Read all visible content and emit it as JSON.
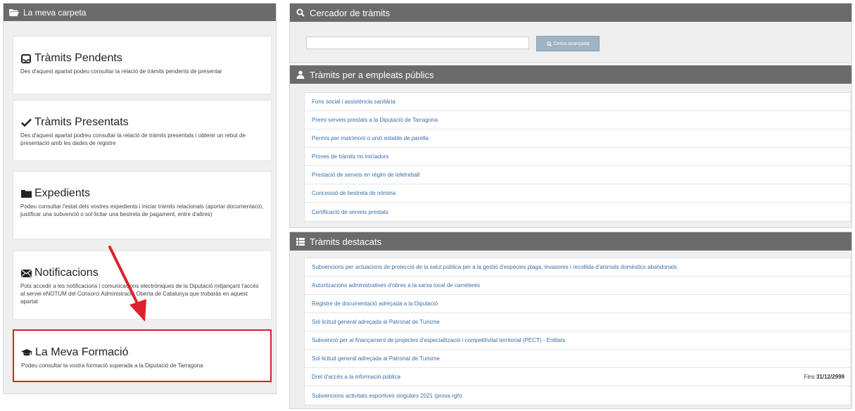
{
  "left_panel": {
    "title": "La meva carpeta",
    "cards": [
      {
        "title": "Tràmits Pendents",
        "desc": "Des d'aquest apartat podeu consultar la relació de tràmits pendents de presentar",
        "icon": "inbox-icon"
      },
      {
        "title": "Tràmits Presentats",
        "desc": "Des d'aquest apartat podreu consultar la relació de tràmits presentats i obtenir un rebut de presentació amb les dades de registre",
        "icon": "check-icon"
      },
      {
        "title": "Expedients",
        "desc": "Podeu consultar l'estat dels vostres expedients i iniciar tràmits relacionats (aportar documentació, justificar una subvenció o sol·licitar una bestreta de pagament, entre d'altres)",
        "icon": "folder-icon"
      },
      {
        "title": "Notificacions",
        "desc": "Pots accedir a les notificacions i comunicacions electròniques de la Diputació mitjançant l'accés al servei eNOTUM del Consorci Administració Oberta de Catalunya que trobaràs en aquest apartat",
        "icon": "envelope-icon"
      },
      {
        "title": "La Meva Formació",
        "desc": "Podeu consultar la vostra formació superada a la Diputació de Tarragona",
        "icon": "graduation-cap-icon"
      }
    ]
  },
  "search_panel": {
    "title": "Cercador de tràmits",
    "input_value": "",
    "button_label": "Cerca avançada"
  },
  "employees_panel": {
    "title": "Tràmits per a empleats públics",
    "items": [
      "Fons social i assistència sanitària",
      "Premi serveis prestats a la Diputació de Tarragona",
      "Permís per matrimoni o unió estable de parella",
      "Proves de tràmits no iniciadors",
      "Prestació de serveis en règim de teletreball",
      "Concessió de bestreta de nòmina",
      "Certificació de serveis prestats"
    ]
  },
  "featured_panel": {
    "title": "Tràmits destacats",
    "items": [
      {
        "label": "Subvencions per actuacions de protecció de la salut pública per a la gestió d'espècies plaga, invasores i recollida d'animals domèstics abandonats",
        "fins": "",
        "date": ""
      },
      {
        "label": "Autoritzacions administratives d'obres a la xarxa local de carreteres",
        "fins": "",
        "date": ""
      },
      {
        "label": "Registre de documentació adreçada a la Diputació",
        "fins": "",
        "date": ""
      },
      {
        "label": "Sol·licitud general adreçada al Patronat de Turisme",
        "fins": "",
        "date": ""
      },
      {
        "label": "Subvenció per al finançament de projectes d'especialització i competitivitat territorial (PECT) - Entitats",
        "fins": "",
        "date": ""
      },
      {
        "label": "Sol·licitud general adreçada al Patronat de Turisme",
        "fins": "",
        "date": ""
      },
      {
        "label": "Dret d'accés a la informació pública",
        "fins": "Fins",
        "date": "31/12/2999"
      },
      {
        "label": "Subvencions activitats esportives singulars 2021 (prova rgh)",
        "fins": "",
        "date": ""
      }
    ]
  },
  "colors": {
    "panel_header": "#6b6b6b",
    "link": "#3a6fa8",
    "highlight_border": "#d4202c",
    "arrow": "#e0202a",
    "search_button": "#9eb3c4"
  }
}
